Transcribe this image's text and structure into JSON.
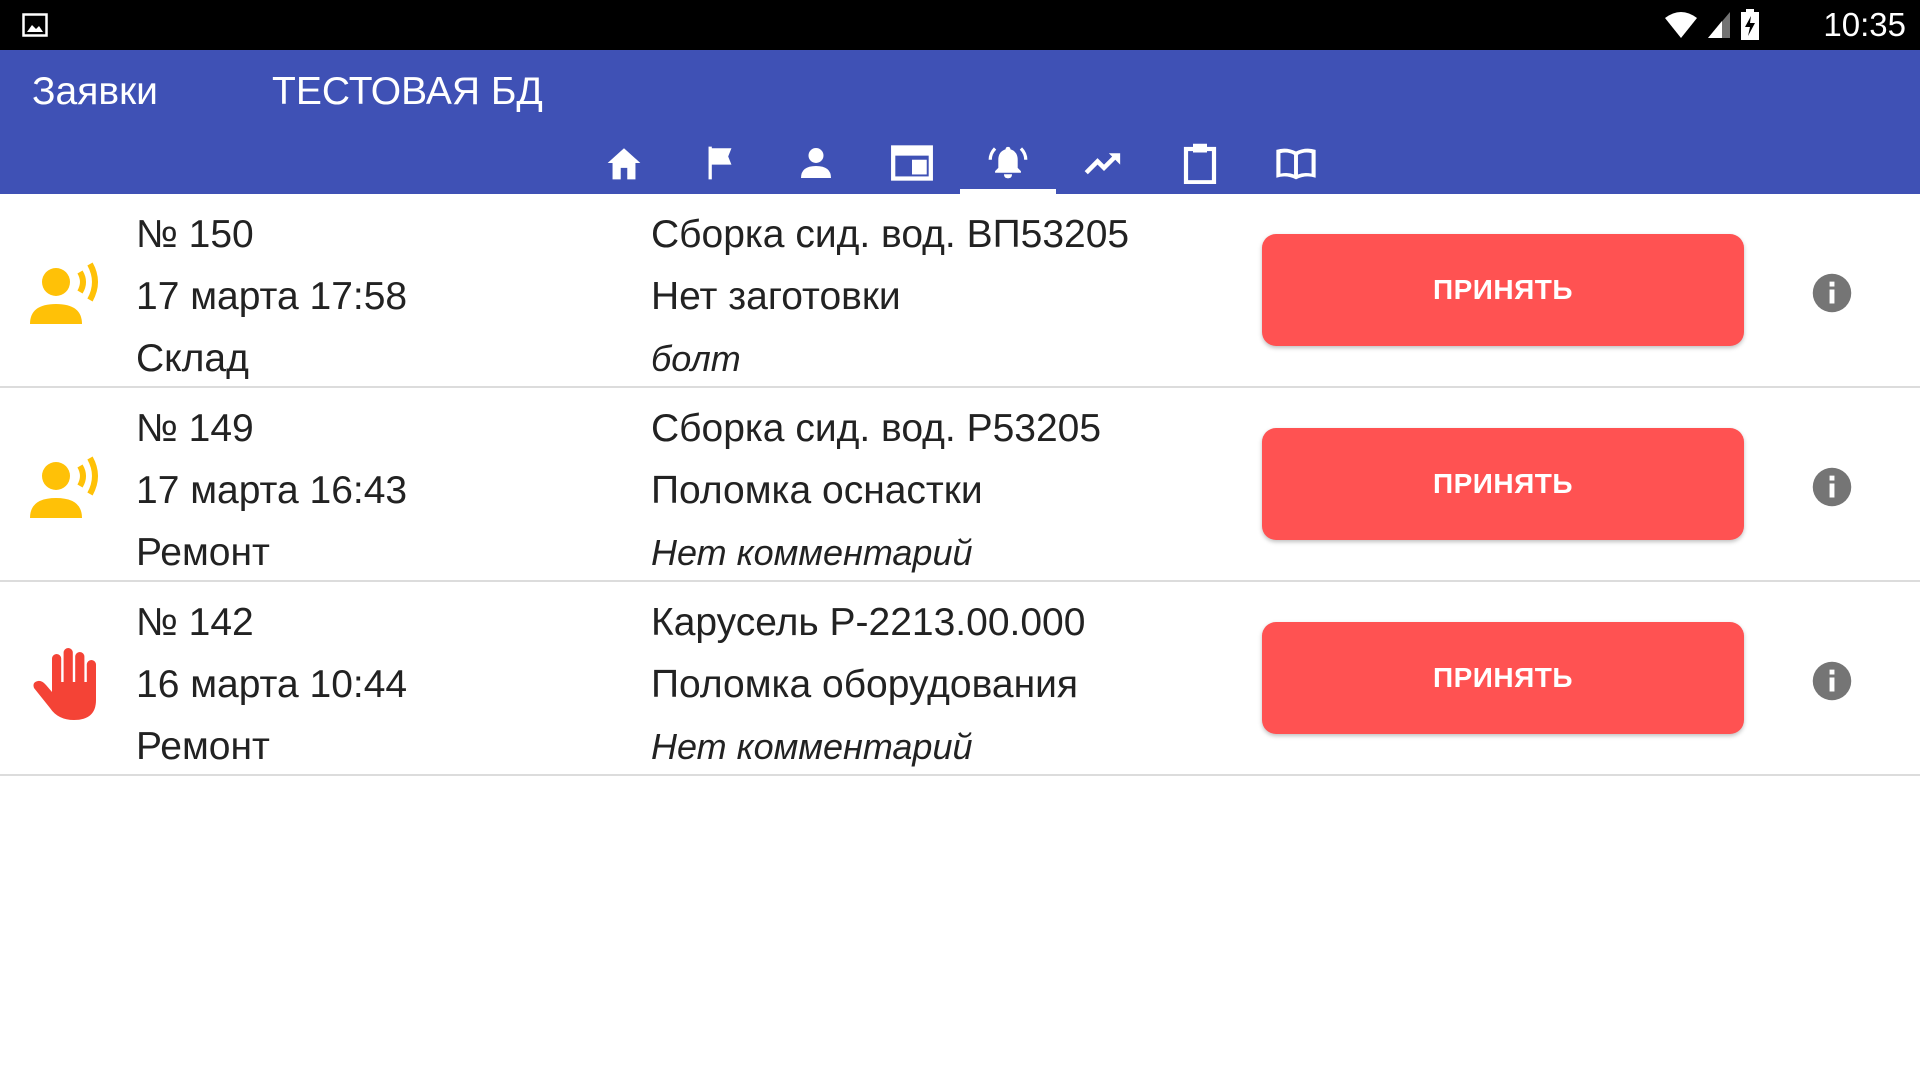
{
  "status_bar": {
    "time": "10:35",
    "icons": [
      "gallery-icon",
      "wifi-icon",
      "signal-icon",
      "battery-charging-icon"
    ]
  },
  "app_bar": {
    "title": "Заявки",
    "subtitle": "ТЕСТОВАЯ БД",
    "tabs": [
      {
        "icon": "home-icon",
        "active": false
      },
      {
        "icon": "flag-icon",
        "active": false
      },
      {
        "icon": "person-icon",
        "active": false
      },
      {
        "icon": "window-icon",
        "active": false
      },
      {
        "icon": "bell-ringing-icon",
        "active": true
      },
      {
        "icon": "trending-up-icon",
        "active": false
      },
      {
        "icon": "clipboard-icon",
        "active": false
      },
      {
        "icon": "book-icon",
        "active": false
      }
    ]
  },
  "requests": [
    {
      "number": "№ 150",
      "datetime": "17 марта 17:58",
      "department": "Склад",
      "object": "Сборка сид. вод. ВП53205",
      "reason": "Нет заготовки",
      "comment": "болт",
      "type_icon": "person-speaking-icon",
      "button_label": "ПРИНЯТЬ"
    },
    {
      "number": "№ 149",
      "datetime": "17 марта 16:43",
      "department": "Ремонт",
      "object": "Сборка сид. вод. Р53205",
      "reason": "Поломка оснастки",
      "comment": "Нет комментарий",
      "type_icon": "person-speaking-icon",
      "button_label": "ПРИНЯТЬ"
    },
    {
      "number": "№ 142",
      "datetime": "16 марта 10:44",
      "department": "Ремонт",
      "object": "Карусель Р-2213.00.000",
      "reason": "Поломка оборудования",
      "comment": "Нет комментарий",
      "type_icon": "hand-stop-icon",
      "button_label": "ПРИНЯТЬ"
    }
  ],
  "colors": {
    "status_bar": "#000000",
    "app_bar": "#3f51b5",
    "accept_button": "#ff5252",
    "speaking_icon": "#ffc107",
    "hand_icon": "#f44336",
    "info_icon": "#757575"
  }
}
